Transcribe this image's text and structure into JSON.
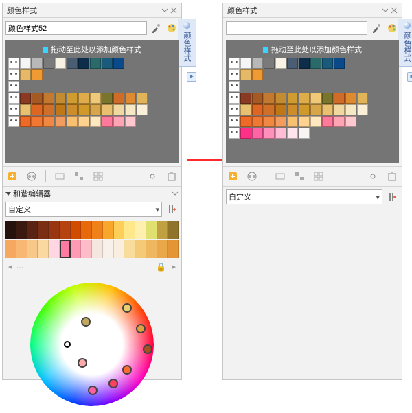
{
  "left": {
    "title": "颜色样式",
    "sideTab": "颜色样式",
    "styleName": "颜色样式52",
    "dropHint": "拖动至此处以添加颜色样式",
    "swatches": [
      [
        "face",
        "#f5f5f5",
        "#b8b8b8",
        "#7a7a7a",
        "#f7f2e3",
        "#4a5d73",
        "#0e2d4a",
        "#2a6a6a",
        "#1a5a7a",
        "#0a4a8a",
        "-",
        "-"
      ],
      [
        "face",
        "#e5b968",
        "#ef9a32",
        "-",
        "-",
        "-",
        "-",
        "-",
        "-",
        "-",
        "-",
        "-"
      ],
      [
        "face",
        "-",
        "-",
        "-",
        "-",
        "-",
        "-",
        "-",
        "-",
        "-",
        "-",
        "-"
      ],
      [
        "face",
        "#8a3a22",
        "#a55a25",
        "#c37a30",
        "#c38c30",
        "#d09c30",
        "#dfac4a",
        "#efc878",
        "#7a752c",
        "#d06c28",
        "#e08a30",
        "#e2b458"
      ],
      [
        "face",
        "#e8c070",
        "#dc6622",
        "#d07028",
        "#c07816",
        "#cf8c2a",
        "#d0992a",
        "#d8a64a",
        "#e8c070",
        "#f0d8a0",
        "#f6e8c2",
        "#faf0d8"
      ],
      [
        "face",
        "#ee6a26",
        "#f07832",
        "#f08842",
        "#f29c60",
        "#f8c070",
        "#ffd290",
        "#ffe8c0",
        "#ff7a9a",
        "#ffa4b4",
        "#ffc8ce",
        "-"
      ]
    ],
    "harmonyTitle": "和谐编辑器",
    "comboValue": "自定义",
    "harmonyTop": [
      "#26120c",
      "#3a1a10",
      "#5a2414",
      "#7a2e14",
      "#983612",
      "#b64210",
      "#d24c00",
      "#e66a0c",
      "#f08018",
      "#f8a62c",
      "#fdcf58",
      "#ffe88a",
      "#fff0b0",
      "#e0e070",
      "#c0a040",
      "#90742c"
    ],
    "harmonyBot": [
      "#f6a860",
      "#f8b874",
      "#f8c888",
      "#fad8a0",
      "#ffd6e2",
      "#ff7aa0",
      "#ff9ab4",
      "#ffbcc8",
      "#f6e6e0",
      "#f8f0ea",
      "#faeee0",
      "#f8dc9c",
      "#f4ca78",
      "#efb860",
      "#eba84a",
      "#e49634"
    ],
    "selIndex": 5
  },
  "right": {
    "title": "颜色样式",
    "sideTab": "颜色样式",
    "dropHint": "拖动至此处以添加颜色样式",
    "swatches": [
      [
        "face",
        "#f5f5f5",
        "#b8b8b8",
        "#7a7a7a",
        "#f7f2e3",
        "#4a5d73",
        "#0e2d4a",
        "#2a6a6a",
        "#1a5a7a",
        "#0a4a8a",
        "-",
        "-"
      ],
      [
        "face",
        "#e5b968",
        "#ef9a32",
        "-",
        "-",
        "-",
        "-",
        "-",
        "-",
        "-",
        "-",
        "-"
      ],
      [
        "face",
        "-",
        "-",
        "-",
        "-",
        "-",
        "-",
        "-",
        "-",
        "-",
        "-",
        "-"
      ],
      [
        "face",
        "#8a3a22",
        "#a55a25",
        "#c37a30",
        "#c38c30",
        "#d09c30",
        "#dfac4a",
        "#efc878",
        "#7a752c",
        "#d06c28",
        "#e08a30",
        "#e2b458"
      ],
      [
        "face",
        "#e8c070",
        "#dc6622",
        "#d07028",
        "#c07816",
        "#cf8c2a",
        "#d0992a",
        "#d8a64a",
        "#e8c070",
        "#f0d8a0",
        "#f6e8c2",
        "#faf0d8"
      ],
      [
        "face",
        "#ee6a26",
        "#f07832",
        "#f08842",
        "#f29c60",
        "#f8c070",
        "#ffd290",
        "#ffe8c0",
        "#ff7a9a",
        "#ffa4b4",
        "#ffc8ce",
        "-"
      ],
      [
        "face",
        "#ff3088",
        "#ff64a4",
        "#ff90bc",
        "#ffbcd4",
        "#ffe4ee",
        "#f8f4f4",
        "-",
        "-",
        "-",
        "-",
        "-"
      ]
    ],
    "comboValue": "自定义"
  }
}
